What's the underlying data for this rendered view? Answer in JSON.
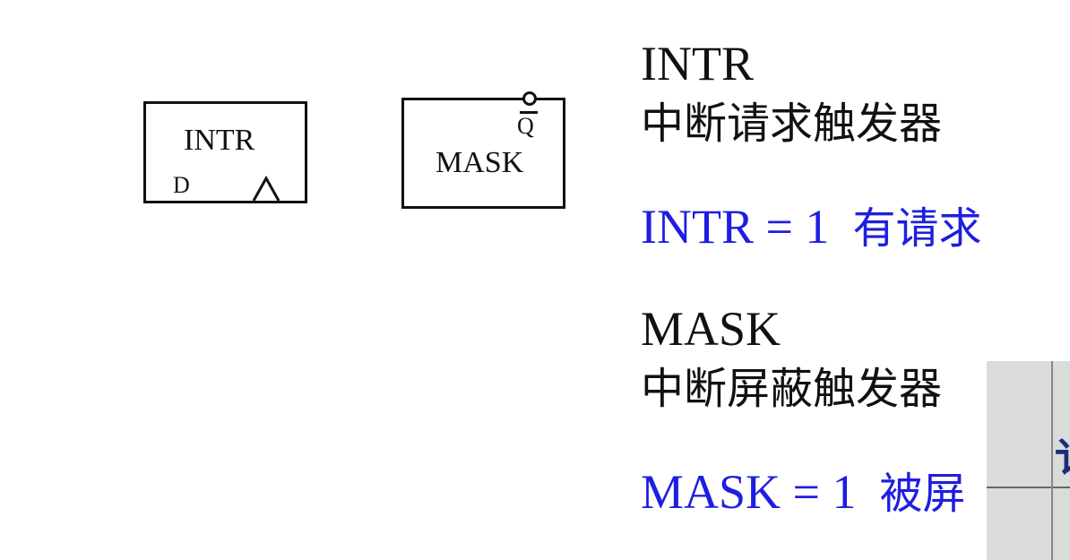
{
  "diagram": {
    "intr_box": {
      "label": "INTR",
      "input_pin": "D"
    },
    "mask_box": {
      "label": "MASK",
      "output_pin": "Q"
    }
  },
  "descriptions": {
    "intr_title": "INTR",
    "intr_cn": "中断请求触发器",
    "intr_eq": "INTR = 1",
    "intr_eq_cn": "有请求",
    "mask_title": "MASK",
    "mask_cn": "中断屏蔽触发器",
    "mask_eq": "MASK = 1",
    "mask_eq_cn": "被屏"
  },
  "video_overlay": {
    "visible_char": "讠"
  },
  "colors": {
    "text": "#111111",
    "highlight": "#1e1ee0"
  }
}
